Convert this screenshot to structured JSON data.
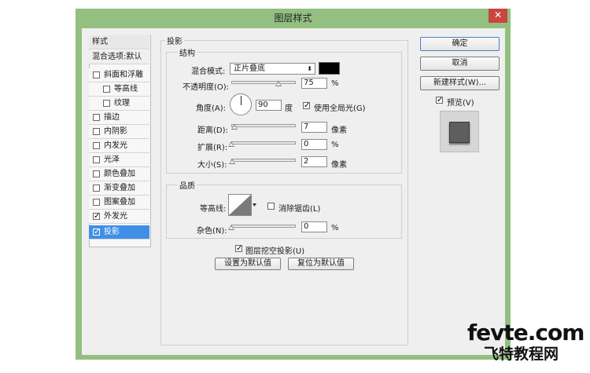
{
  "dialog": {
    "title": "图层样式",
    "close": "✕"
  },
  "styles": {
    "header": "样式",
    "blending": "混合选项:默认",
    "items": [
      {
        "label": "斜面和浮雕",
        "checked": false
      },
      {
        "label": "等高线",
        "checked": false
      },
      {
        "label": "纹理",
        "checked": false
      },
      {
        "label": "描边",
        "checked": false
      },
      {
        "label": "内阴影",
        "checked": false
      },
      {
        "label": "内发光",
        "checked": false
      },
      {
        "label": "光泽",
        "checked": false
      },
      {
        "label": "颜色叠加",
        "checked": false
      },
      {
        "label": "渐变叠加",
        "checked": false
      },
      {
        "label": "图案叠加",
        "checked": false
      },
      {
        "label": "外发光",
        "checked": true
      },
      {
        "label": "投影",
        "checked": true,
        "selected": true
      }
    ]
  },
  "panel": {
    "title": "投影",
    "structure": {
      "legend": "结构",
      "blend_mode_label": "混合模式:",
      "blend_mode_value": "正片叠底",
      "blend_color": "#000000",
      "opacity_label": "不透明度(O):",
      "opacity_value": "75",
      "opacity_unit": "%",
      "angle_label": "角度(A):",
      "angle_value": "90",
      "angle_unit": "度",
      "global_light_label": "使用全局光(G)",
      "global_light_checked": true,
      "distance_label": "距离(D):",
      "distance_value": "7",
      "distance_unit": "像素",
      "spread_label": "扩展(R):",
      "spread_value": "0",
      "spread_unit": "%",
      "size_label": "大小(S):",
      "size_value": "2",
      "size_unit": "像素"
    },
    "quality": {
      "legend": "品质",
      "contour_label": "等高线:",
      "antialias_label": "消除锯齿(L)",
      "antialias_checked": false,
      "noise_label": "杂色(N):",
      "noise_value": "0",
      "noise_unit": "%"
    },
    "knockout_label": "图层挖空投影(U)",
    "knockout_checked": true,
    "make_default": "设置为默认值",
    "reset_default": "复位为默认值"
  },
  "buttons": {
    "ok": "确定",
    "cancel": "取消",
    "new_style": "新建样式(W)...",
    "preview_label": "预览(V)",
    "preview_checked": true
  },
  "watermark": {
    "line1": "fevte.com",
    "line2": "飞特教程网"
  },
  "colors": {
    "frame": "#93bf80",
    "selection": "#3f8fe6",
    "close": "#c8463e"
  }
}
